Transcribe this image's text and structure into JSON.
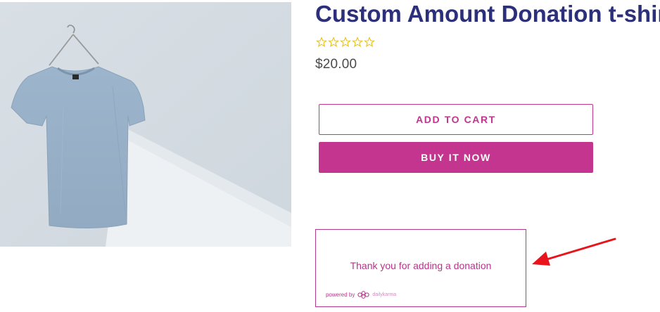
{
  "product": {
    "title": "Custom Amount Donation t-shirt",
    "price": "$20.00",
    "rating": {
      "stars_filled": 0,
      "stars_total": 5
    }
  },
  "buttons": {
    "add_to_cart": "ADD TO CART",
    "buy_it_now": "BUY IT NOW"
  },
  "donation_widget": {
    "message": "Thank you for adding a donation",
    "powered_by": "powered by",
    "provider": "dailykarma"
  },
  "colors": {
    "title": "#2c2f7a",
    "accent": "#c4358f",
    "star": "#e8c21a",
    "annotation_arrow": "#e8131b"
  },
  "icons": {
    "star": "star-outline-icon",
    "logo": "dailykarma-logo-icon",
    "annotation": "red-arrow-icon"
  }
}
